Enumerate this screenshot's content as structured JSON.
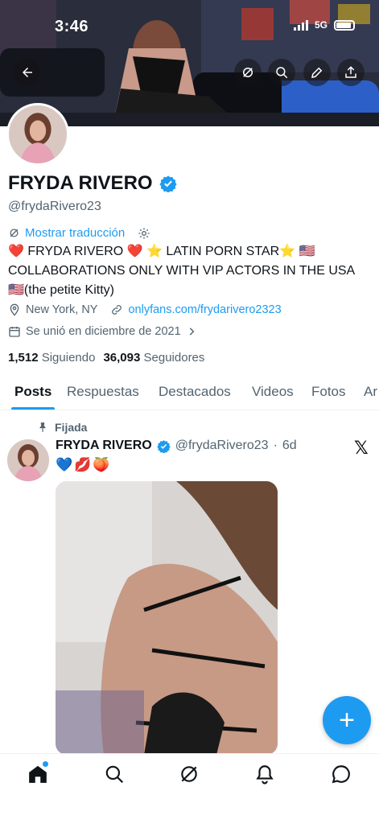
{
  "status_bar": {
    "time": "3:46",
    "network": "5G"
  },
  "profile": {
    "name": "FRYDA RIVERO",
    "handle": "@frydaRivero23",
    "translate_label": "Mostrar traducción",
    "bio_line1": "❤️ FRYDA RIVERO ❤️ ⭐ LATIN PORN STAR⭐ 🇺🇸",
    "bio_line2": "COLLABORATIONS ONLY WITH VIP ACTORS IN THE USA",
    "bio_line3": "🇺🇸(the petite Kitty)",
    "location": "New York, NY",
    "website": "onlyfans.com/frydarivero2323",
    "joined": "Se unió en diciembre de 2021",
    "following_count": "1,512",
    "following_label": "Siguiendo",
    "followers_count": "36,093",
    "followers_label": "Seguidores"
  },
  "tabs": [
    {
      "label": "Posts",
      "active": true
    },
    {
      "label": "Respuestas"
    },
    {
      "label": "Destacados"
    },
    {
      "label": "Videos"
    },
    {
      "label": "Fotos"
    },
    {
      "label": "Ar"
    }
  ],
  "post": {
    "pinned_label": "Fijada",
    "author_name": "FRYDA RIVERO",
    "author_handle": "@frydaRivero23",
    "separator": "·",
    "age": "6d",
    "text": "💙💋🍑",
    "x_logo": "𝕏"
  },
  "fab_label": "+",
  "colors": {
    "accent": "#1d9bf0",
    "text": "#0f1419",
    "secondary": "#536471"
  },
  "icons": {
    "back": "arrow-left-icon",
    "grok": "grok-icon",
    "search": "search-icon",
    "edit": "pencil-icon",
    "share": "share-icon"
  }
}
